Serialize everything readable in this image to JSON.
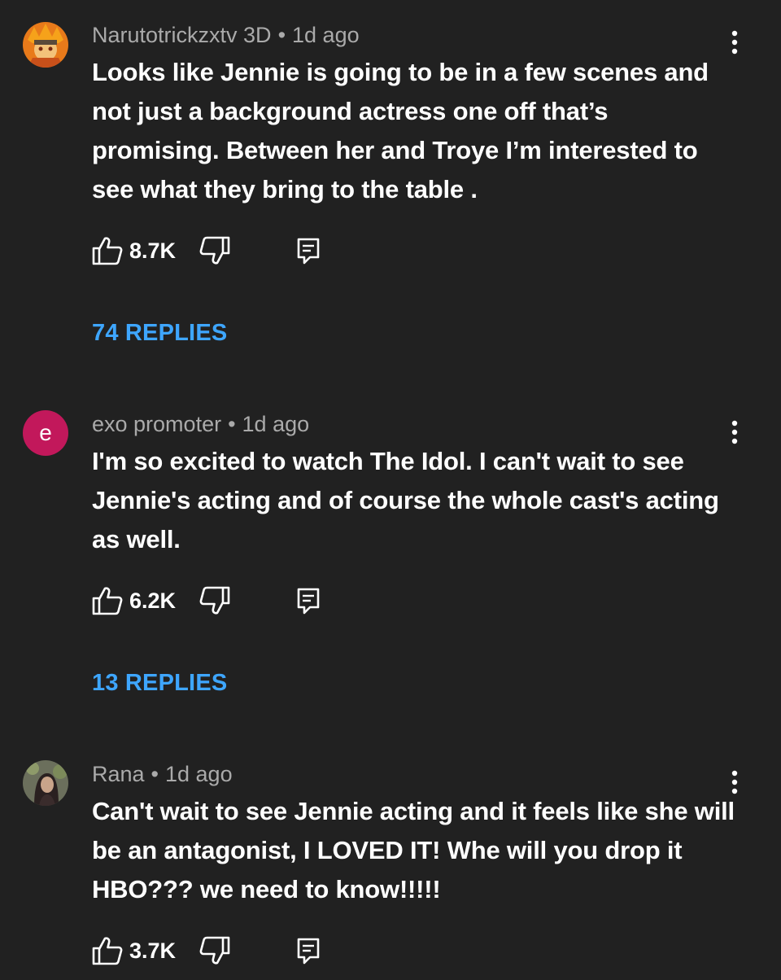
{
  "comments": [
    {
      "author": "Narutotrickzxtv 3D",
      "separator": "•",
      "time": "1d ago",
      "text": "Looks like Jennie is going to be in a few scenes and not just a background actress one off that’s promising. Between her and Troye I’m interested to see what they bring to the table .",
      "likes": "8.7K",
      "replies": "74 REPLIES",
      "avatar_type": "image",
      "avatar_icon": "orange-anime-avatar"
    },
    {
      "author": "exo promoter",
      "separator": "•",
      "time": "1d ago",
      "text": "I'm so excited to watch The Idol. I can't wait to see Jennie's acting and of course the whole cast's acting as well.",
      "likes": "6.2K",
      "replies": "13 REPLIES",
      "avatar_type": "letter",
      "avatar_letter": "e",
      "avatar_color": "#c2185b"
    },
    {
      "author": "Rana",
      "separator": "•",
      "time": "1d ago",
      "text": "Can't wait to see Jennie acting and it feels like she will be an antagonist, I LOVED IT! Whe will you drop it HBO??? we need to know!!!!!",
      "likes": "3.7K",
      "avatar_type": "image",
      "avatar_icon": "portrait-avatar"
    }
  ],
  "colors": {
    "background": "#212121",
    "meta": "#aaaaaa",
    "text": "#ffffff",
    "link": "#3ea6ff"
  },
  "icons": {
    "like": "thumb-up-icon",
    "dislike": "thumb-down-icon",
    "reply": "reply-icon",
    "more": "more-vert-icon"
  }
}
